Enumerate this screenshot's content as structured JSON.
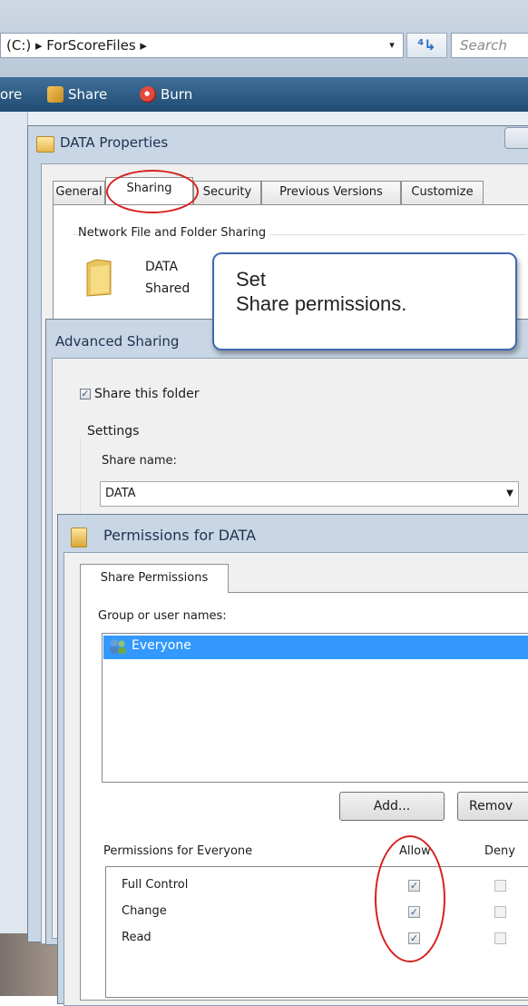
{
  "explorer": {
    "address": "(C:)  ▸  ForScoreFiles  ▸",
    "address_dropdown": "▾",
    "refresh_glyph": "⁴↳",
    "search_placeholder": "Search",
    "toolbar": {
      "organize_fragment": "ore",
      "share_label": "Share",
      "burn_label": "Burn"
    }
  },
  "properties": {
    "title": "DATA Properties",
    "tabs": [
      "General",
      "Sharing",
      "Security",
      "Previous Versions",
      "Customize"
    ],
    "active_tab": "Sharing",
    "group_title": "Network File and Folder Sharing",
    "folder_name": "DATA",
    "folder_state": "Shared"
  },
  "callout": {
    "line1": "Set",
    "line2": "Share permissions."
  },
  "advanced": {
    "title": "Advanced Sharing",
    "share_checkbox_label": "Share this folder",
    "share_checked": true,
    "settings_label": "Settings",
    "share_name_label": "Share name:",
    "share_name_value": "DATA"
  },
  "permissions": {
    "title": "Permissions for DATA",
    "tab_label": "Share Permissions",
    "group_label": "Group or user names:",
    "users": [
      "Everyone"
    ],
    "add_button": "Add...",
    "remove_button": "Remov",
    "perm_header": "Permissions for Everyone",
    "allow_header": "Allow",
    "deny_header": "Deny",
    "rows": [
      {
        "name": "Full Control",
        "allow": true,
        "deny": false
      },
      {
        "name": "Change",
        "allow": true,
        "deny": false
      },
      {
        "name": "Read",
        "allow": true,
        "deny": false
      }
    ]
  },
  "colors": {
    "highlight_oval": "#d82020",
    "selection": "#3399ff",
    "callout_border": "#3f68b1"
  }
}
